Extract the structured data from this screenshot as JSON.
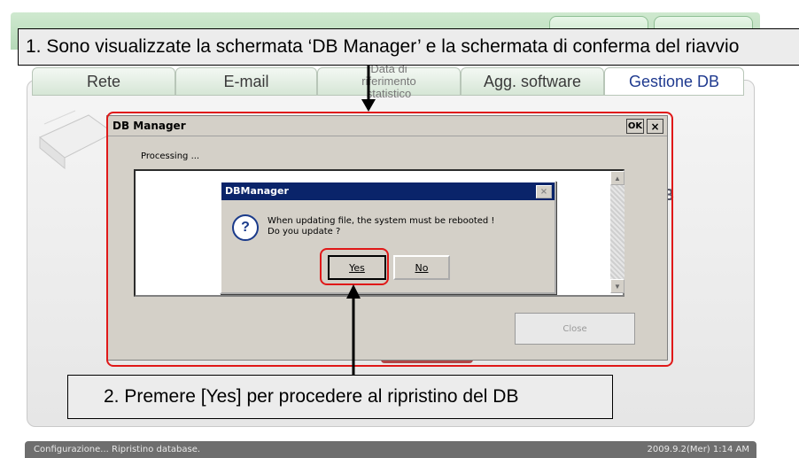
{
  "tabs": [
    {
      "label": "Rete"
    },
    {
      "label": "E-mail"
    },
    {
      "label": "Data di riferimento statistico"
    },
    {
      "label": "Agg. software"
    },
    {
      "label": "Gestione DB"
    }
  ],
  "db_manager": {
    "title": "DB Manager",
    "ok_label": "OK",
    "close_x": "×",
    "processing_text": "Processing ...",
    "close_button": "Close"
  },
  "confirm_dialog": {
    "title": "DBManager",
    "close_x": "×",
    "message_line1": "When updating file, the system must be rebooted !",
    "message_line2": "Do you update ?",
    "yes_label": "Yes",
    "no_label": "No"
  },
  "background": {
    "partial_letter": "B"
  },
  "status_bar": {
    "left_text": "Configurazione... Ripristino database.",
    "right_text": "2009.9.2(Mer)  1:14 AM"
  },
  "annotations": {
    "step1": "1. Sono visualizzate la schermata ‘DB Manager’ e la schermata di conferma del riavvio",
    "step2": "2. Premere [Yes] per procedere al ripristino del DB"
  },
  "colors": {
    "highlight_red": "#e01818",
    "dialog_title_blue": "#0a246a",
    "active_tab_text": "#1f3a8f"
  }
}
